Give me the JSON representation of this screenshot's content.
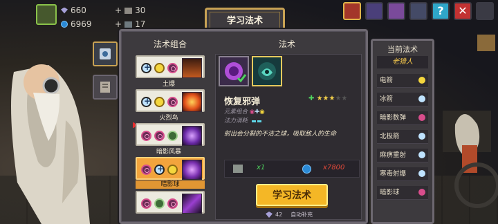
{
  "hud": {
    "gems": "660",
    "coins": "6969",
    "material_a": "30",
    "material_b": "17"
  },
  "dialog": {
    "tab_title": "学习法术",
    "combo_header": "法术组合",
    "spell_header": "法术",
    "combos": [
      {
        "label": "土爆",
        "elements": [
          "plus",
          "sun",
          "ring"
        ]
      },
      {
        "label": "火烈鸟",
        "elements": [
          "plus",
          "sun",
          "ring"
        ]
      },
      {
        "label": "暗影风暴",
        "elements": [
          "ring",
          "ring",
          "gr"
        ]
      },
      {
        "label": "暗影球",
        "elements": [
          "ring",
          "plus",
          "sun"
        ],
        "selected": true
      },
      {
        "label": "",
        "elements": [
          "ring",
          "gr",
          "ring"
        ]
      }
    ],
    "spell": {
      "name": "恢复邪弹",
      "element_label": "元素组合",
      "mana_label": "法力消耗",
      "description": "射出会分裂的不洁之球，吸取敌人的生命",
      "cost_item_amount": "x1",
      "cost_coin_amount": "x7800",
      "learn_button": "学习法术",
      "refill_count": "42",
      "refill_label": "自动补充"
    }
  },
  "current": {
    "title": "当前法术",
    "character": "老猎人",
    "spells": [
      {
        "name": "电箭",
        "icon": "sun"
      },
      {
        "name": "冰箭",
        "icon": "plus"
      },
      {
        "name": "暗影数弹",
        "icon": "ring"
      },
      {
        "name": "北极箭",
        "icon": "plus-plus"
      },
      {
        "name": "麻痹重射",
        "icon": "plus-plus"
      },
      {
        "name": "寒毒射爆",
        "icon": "plus-plus"
      },
      {
        "name": "暗影球",
        "icon": "ring-sun"
      }
    ]
  },
  "colors": {
    "accent_gold": "#c8a254",
    "button_yellow": "#f4b726",
    "panel_bg": "#3d3a3e"
  }
}
